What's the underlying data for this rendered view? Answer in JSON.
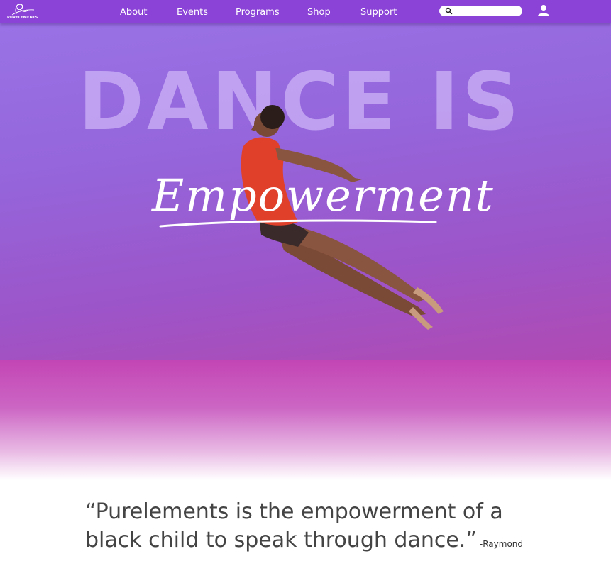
{
  "nav": {
    "logo_text": "PURELEMENTS",
    "links": [
      "About",
      "Events",
      "Programs",
      "Shop",
      "Support"
    ],
    "search_placeholder": ""
  },
  "hero": {
    "title": "DANCE IS",
    "script_word": "Empowerment"
  },
  "quote": {
    "line1": "“Purelements is the empowerment of a",
    "line2": "black child to speak through dance.”",
    "author": "-Raymond"
  },
  "colors": {
    "nav": "#8a43d6",
    "hero_top": "#9a72e6",
    "band": "#c345b5",
    "quote_text": "#444444"
  },
  "icons": [
    "search-icon",
    "user-icon",
    "logo-mark"
  ]
}
